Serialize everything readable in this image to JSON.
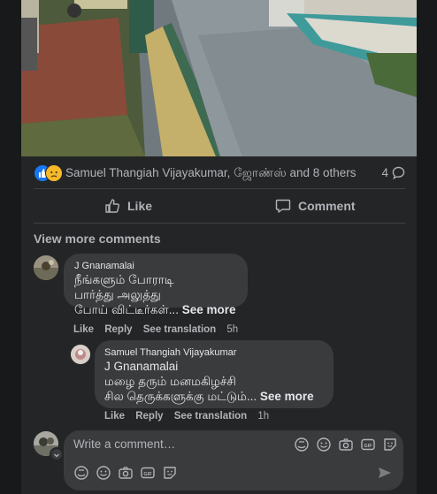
{
  "post": {
    "reactions": {
      "icons": [
        "like-reaction-icon",
        "sad-reaction-icon"
      ],
      "names_text": "Samuel Thangiah Vijayakumar, ஜோண்ஸ் and 8 others",
      "comment_count": "4"
    },
    "actions": {
      "like_label": "Like",
      "comment_label": "Comment"
    }
  },
  "comments": {
    "view_more_label": "View more comments",
    "items": [
      {
        "author": "J Gnanamalai",
        "lines": [
          "நீங்களும் போராடி",
          "பார்த்து அலுத்து",
          "போய் விட்டீர்கள்..."
        ],
        "see_more": "See more",
        "like": "Like",
        "reply": "Reply",
        "see_translation": "See translation",
        "time": "5h"
      }
    ],
    "reply": {
      "author": "Samuel Thangiah Vijayakumar",
      "mention": "J Gnanamalai",
      "lines": [
        "மழை தரும் மனமகிழச்சி",
        "சில தெருக்களுக்கு மட்டும்..."
      ],
      "see_more": "See more",
      "like": "Like",
      "reply": "Reply",
      "see_translation": "See translation",
      "time": "1h"
    }
  },
  "composer": {
    "placeholder": "Write a comment…",
    "tool_icons": [
      "avatar-sticker-icon",
      "emoji-icon",
      "camera-icon",
      "gif-icon",
      "sticker-icon"
    ],
    "send_icon": "send-icon"
  },
  "colors": {
    "background": "#18191a",
    "card": "#242526",
    "bubble": "#3a3b3c",
    "primary_text": "#e4e6eb",
    "secondary_text": "#b0b3b8",
    "like_blue": "#1877f2",
    "sad_yellow": "#f7b928"
  }
}
